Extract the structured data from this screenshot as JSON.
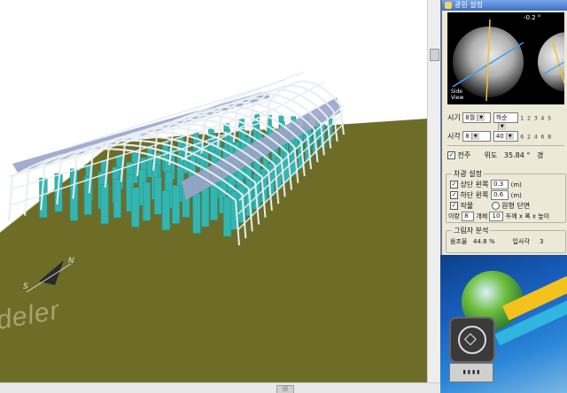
{
  "scene": {
    "watermark": "deler",
    "compass_n": "N",
    "compass_s": "S",
    "colors": {
      "ground": "#6e6d28",
      "frame": "#e8eef2",
      "cover": "#9aa4c8",
      "plants": "#35b5b0"
    }
  },
  "panel": {
    "title": "광원 설정",
    "sun_angle": "-0.2 °",
    "side_view": [
      "Side",
      "View"
    ],
    "time_row": {
      "label": "시기",
      "month": "8월",
      "period": "하순"
    },
    "hour_row": {
      "label": "시각",
      "hour": "8",
      "minute": "40"
    },
    "scale_top": "1 2 3 4 5",
    "scale_bottom": "6 2 4 6 8",
    "location_row": {
      "check": "✓",
      "label": "전주",
      "lat_label": "위도",
      "lat_value": "35.84",
      "deg": "°",
      "lon_label": "경"
    },
    "shade_group": {
      "title": "차광 설정",
      "upper_label": "상단 왼쪽",
      "upper_value": "0.3",
      "upper_unit": "(m)",
      "lower_label": "하단 왼쪽",
      "lower_value": "0.6",
      "lower_unit": "(m)",
      "crop_label": "작물",
      "circle_label": "원형 단면",
      "spacing_label": "이랑",
      "spacing_value": "8",
      "count_label": "개체",
      "count_value": "10",
      "size_label": "두께 x 폭 x 높이"
    },
    "shadow_group": {
      "title": "그림자 분석",
      "ratio_label": "음조율",
      "ratio_value": "44.8 %",
      "incidence_label": "입사각",
      "incidence_value": "3"
    }
  }
}
